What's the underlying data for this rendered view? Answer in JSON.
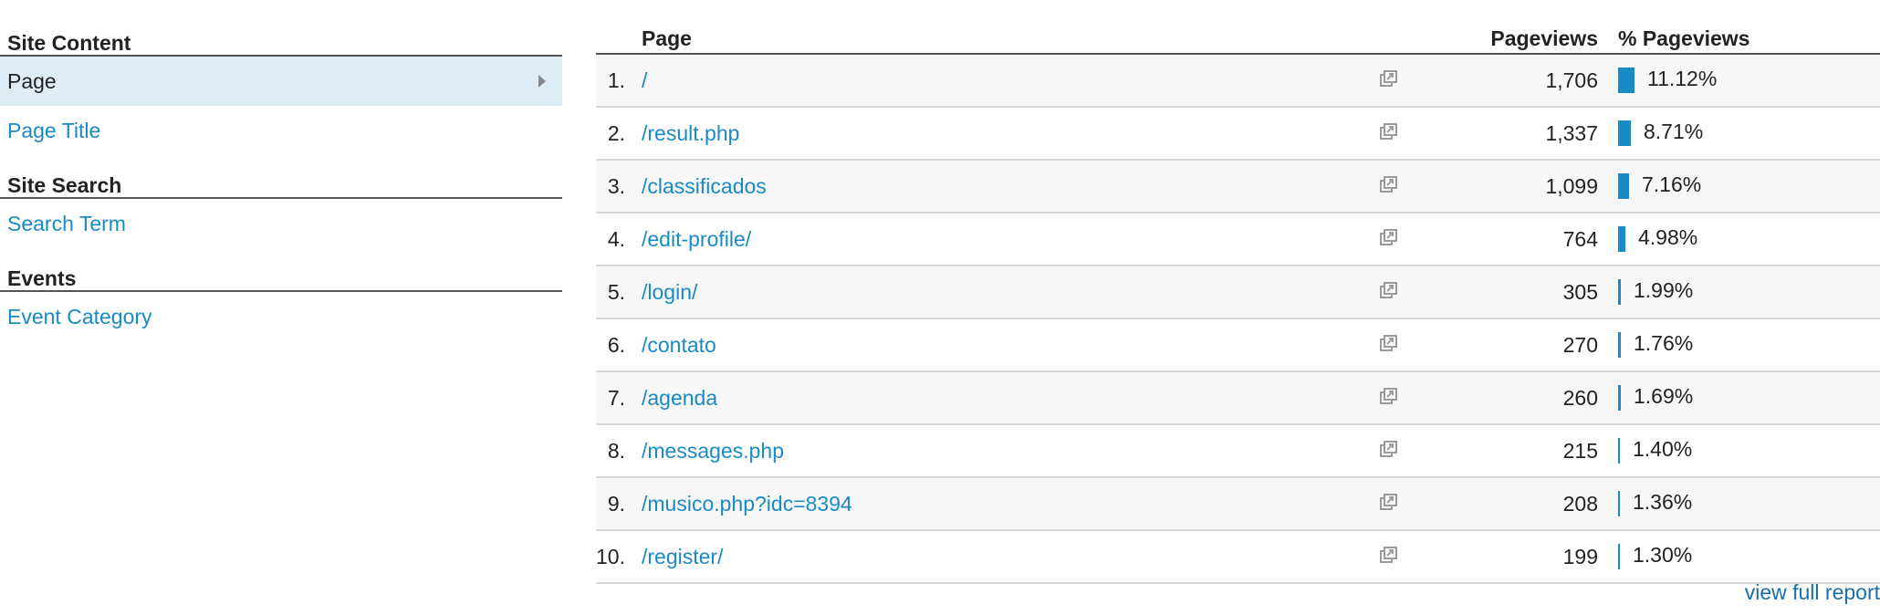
{
  "left_nav": {
    "site_content": {
      "heading": "Site Content",
      "items": [
        "Page",
        "Page Title"
      ]
    },
    "site_search": {
      "heading": "Site Search",
      "items": [
        "Search Term"
      ]
    },
    "events": {
      "heading": "Events",
      "items": [
        "Event Category"
      ]
    }
  },
  "table": {
    "headers": {
      "page": "Page",
      "pageviews": "Pageviews",
      "pct_pageviews": "% Pageviews"
    },
    "rows": [
      {
        "num": "1.",
        "page": "/",
        "pageviews": "1,706",
        "pct": "11.12%",
        "pct_value": 11.12
      },
      {
        "num": "2.",
        "page": "/result.php",
        "pageviews": "1,337",
        "pct": "8.71%",
        "pct_value": 8.71
      },
      {
        "num": "3.",
        "page": "/classificados",
        "pageviews": "1,099",
        "pct": "7.16%",
        "pct_value": 7.16
      },
      {
        "num": "4.",
        "page": "/edit-profile/",
        "pageviews": "764",
        "pct": "4.98%",
        "pct_value": 4.98
      },
      {
        "num": "5.",
        "page": "/login/",
        "pageviews": "305",
        "pct": "1.99%",
        "pct_value": 1.99
      },
      {
        "num": "6.",
        "page": "/contato",
        "pageviews": "270",
        "pct": "1.76%",
        "pct_value": 1.76
      },
      {
        "num": "7.",
        "page": "/agenda",
        "pageviews": "260",
        "pct": "1.69%",
        "pct_value": 1.69
      },
      {
        "num": "8.",
        "page": "/messages.php",
        "pageviews": "215",
        "pct": "1.40%",
        "pct_value": 1.4
      },
      {
        "num": "9.",
        "page": "/musico.php?idc=8394",
        "pageviews": "208",
        "pct": "1.36%",
        "pct_value": 1.36
      },
      {
        "num": "10.",
        "page": "/register/",
        "pageviews": "199",
        "pct": "1.30%",
        "pct_value": 1.3
      }
    ]
  },
  "footer": {
    "view_full_report": "view full report"
  },
  "colors": {
    "accent": "#1a8ac6",
    "selected_bg": "#deedf5",
    "row_alt": "#f7f7f7"
  },
  "icons": {
    "row_action": "open-external-icon",
    "selected_arrow": "chevron-right-icon"
  }
}
